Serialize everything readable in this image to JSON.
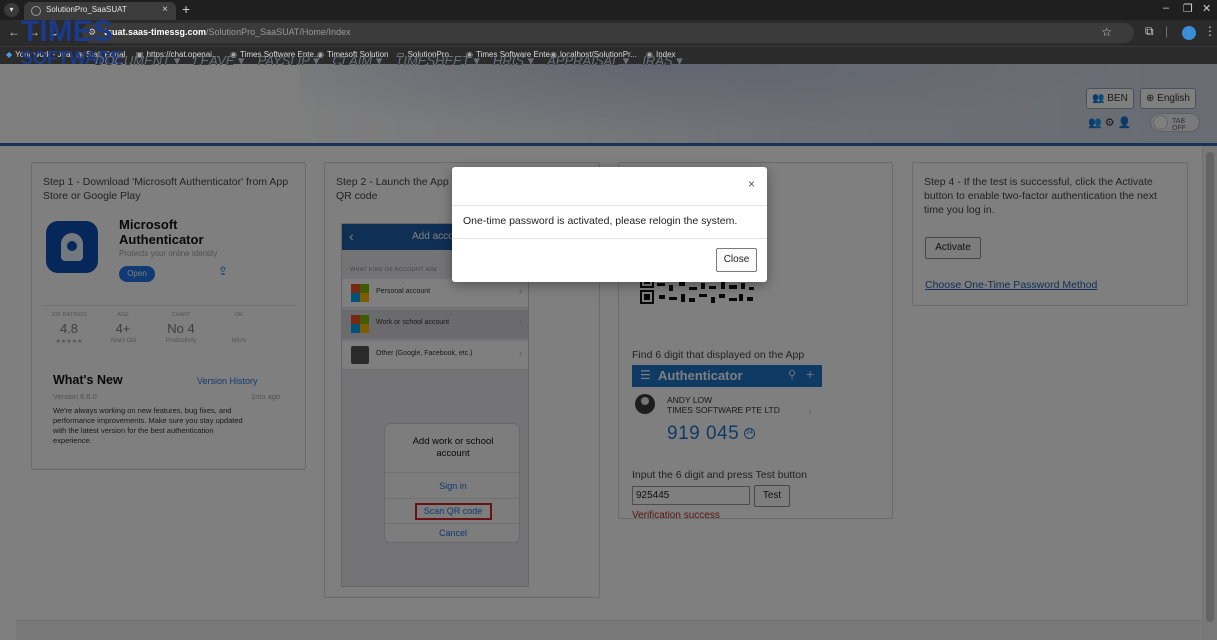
{
  "browser": {
    "tab_title": "SolutionPro_SaaSUAT",
    "tab_close": "×",
    "new_tab": "+",
    "url_host": "tsuat.saas-timessg.com",
    "url_path": "/SolutionPro_SaaSUAT/Home/Index",
    "bookmarks": [
      "Your work - Jira",
      "Staff Portal",
      "https://chat.openai...",
      "Times Software Ente...",
      "Timesoft Solution",
      "SolutionPro",
      "Times Software Ente...",
      "localhost/SolutionPr...",
      "Index"
    ]
  },
  "header": {
    "logo_line1": "TIMES",
    "logo_line2": "SOFTWARE",
    "menu": [
      "DOCUMENT ▾",
      "LEAVE ▾",
      "PAYSLIP ▾",
      "CLAIM ▾",
      "TIMESHEET ▾",
      "HRIS ▾",
      "APPRAISAL ▾",
      "IRAS ▾"
    ],
    "user_button": "BEN",
    "language_button": "English",
    "tab_toggle": "TAB OFF"
  },
  "step1": {
    "text": "Step 1 - Download 'Microsoft Authenticator' from App Store or Google Play",
    "app_name_line1": "Microsoft",
    "app_name_line2": "Authenticator",
    "app_tagline": "Protects your online identity",
    "open_label": "Open",
    "stats": [
      {
        "cap": "10K RATINGS",
        "val": "4.8",
        "sub": "★★★★★"
      },
      {
        "cap": "AGE",
        "val": "4+",
        "sub": "Years Old"
      },
      {
        "cap": "CHART",
        "val": "No 4",
        "sub": "Productivity"
      },
      {
        "cap": "DE",
        "val": "",
        "sub": "Micro"
      }
    ],
    "whats_new": "What's New",
    "version_history": "Version History",
    "version": "Version 6.8.0",
    "ago": "1mo ago",
    "description": "We're always working on new features, bug fixes, and performance improvements. Make sure you stay updated with the latest version for the best authentication experience."
  },
  "step2": {
    "text_line1": "Step 2 - Launch the App",
    "text_line2": "QR code",
    "phone_title": "Add accou",
    "question": "WHAT KIND OF ACCOUNT ARE",
    "accounts": [
      "Personal account",
      "Work or school account",
      "Other (Google, Facebook, etc.)"
    ],
    "sheet_title": "Add work or school account",
    "sign_in": "Sign in",
    "scan_qr": "Scan QR code",
    "cancel": "Cancel"
  },
  "step3": {
    "find_text": "Find 6 digit that displayed on the App",
    "auth_title": "Authenticator",
    "account_name": "ANDY LOW",
    "account_company": "TIMES SOFTWARE PTE LTD",
    "otp_code": "919 045",
    "otp_timer": "24",
    "input_text": "Input the 6 digit and press Test button",
    "input_value": "925445",
    "test_label": "Test",
    "verification": "Verification success"
  },
  "step4": {
    "text": "Step 4 - If the test is successful, click the Activate button to enable two-factor authentication the next time you log in.",
    "activate_label": "Activate",
    "otp_method_link": "Choose One-Time Password Method"
  },
  "modal": {
    "message": "One-time password is activated, please relogin the system.",
    "close_x": "×",
    "close_label": "Close"
  },
  "colors": {
    "brand": "#1b3a8a",
    "accent_rule": "#2e63b3",
    "success_text": "#b12a2a",
    "link": "#1f5fb0"
  }
}
